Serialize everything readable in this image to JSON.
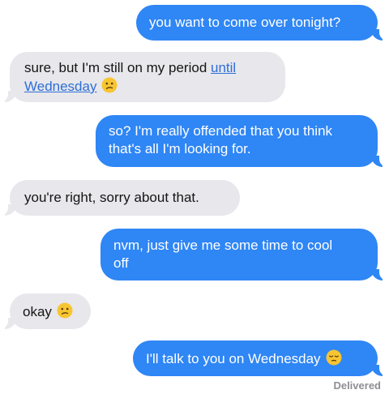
{
  "messages": [
    {
      "from": "me",
      "text": "you want to come over tonight?"
    },
    {
      "from": "them",
      "text_before": "sure, but I'm still on my period ",
      "link_text_1": "until",
      "link_text_2": "Wednesday",
      "emoji": "confused-face"
    },
    {
      "from": "me",
      "line1": "so? I'm really offended that you think",
      "line2": "that's all I'm looking for."
    },
    {
      "from": "them",
      "text": "you're right, sorry about that."
    },
    {
      "from": "me",
      "line1": "nvm, just give me some time to cool",
      "line2": "off"
    },
    {
      "from": "them",
      "text": "okay",
      "emoji": "confused-face"
    },
    {
      "from": "me",
      "text": "I'll talk to you on Wednesday",
      "emoji": "relieved-face"
    }
  ],
  "status": {
    "delivered": "Delivered"
  },
  "colors": {
    "sent_bubble": "#2f86f5",
    "received_bubble": "#e7e7ec",
    "link": "#2f6fd6",
    "emoji": "#f7c531"
  }
}
